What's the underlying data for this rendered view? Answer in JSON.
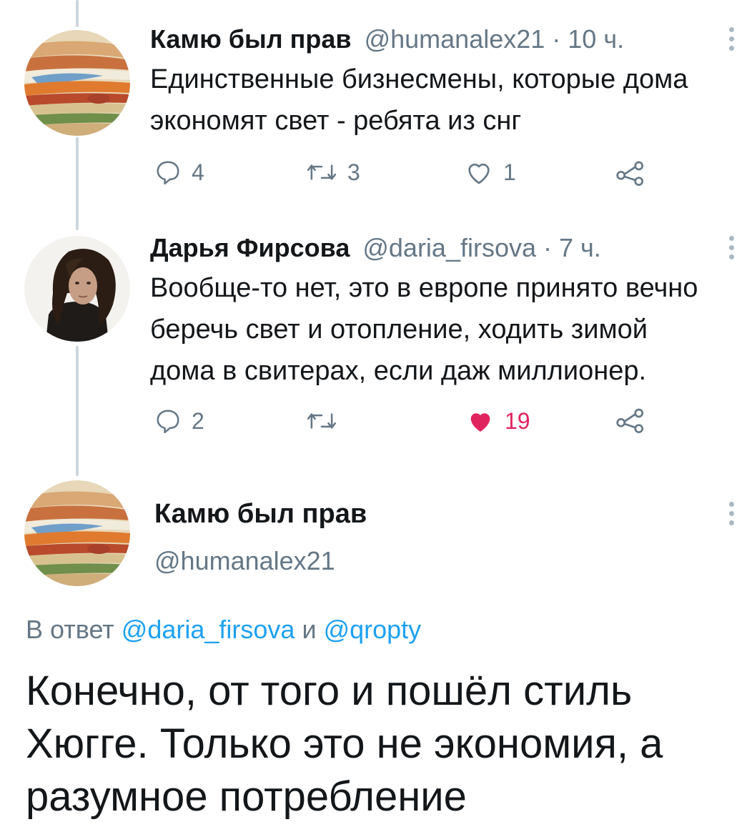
{
  "tweets": [
    {
      "author_name": "Камю был прав",
      "handle": "@humanalex21",
      "separator": " · ",
      "time": "10 ч.",
      "text_lines": [
        "Единственные бизнесмены, которые дома",
        "экономят свет - ребята из снг"
      ],
      "replies": "4",
      "retweets": "3",
      "likes": "1",
      "liked": false,
      "avatar": "jupiter-painting"
    },
    {
      "author_name": "Дарья Фирсова",
      "handle": "@daria_firsova",
      "separator": " · ",
      "time": "7 ч.",
      "text_lines": [
        "Вообще-то нет, это в европе принято вечно",
        "беречь свет и отопление, ходить зимой",
        "дома в свитерах, если даж миллионер."
      ],
      "replies": "2",
      "retweets": "",
      "likes": "19",
      "liked": true,
      "avatar": "woman-photo"
    }
  ],
  "main_tweet": {
    "author_name": "Камю был прав",
    "handle": "@humanalex21",
    "reply_prefix": "В ответ ",
    "mention_1": "@daria_firsova",
    "reply_joiner": " и ",
    "mention_2": "@qropty",
    "text_lines": [
      "Конечно, от того и пошёл стиль",
      "Хюгге. Только это не экономия, а",
      "разумное потребление"
    ]
  },
  "colors": {
    "secondary_text": "#657786",
    "link": "#1da1f2",
    "like_active": "#e0245e",
    "thread_line": "#ccd6dd"
  },
  "icons": [
    "reply-icon",
    "retweet-icon",
    "like-icon",
    "share-icon",
    "more-icon"
  ]
}
